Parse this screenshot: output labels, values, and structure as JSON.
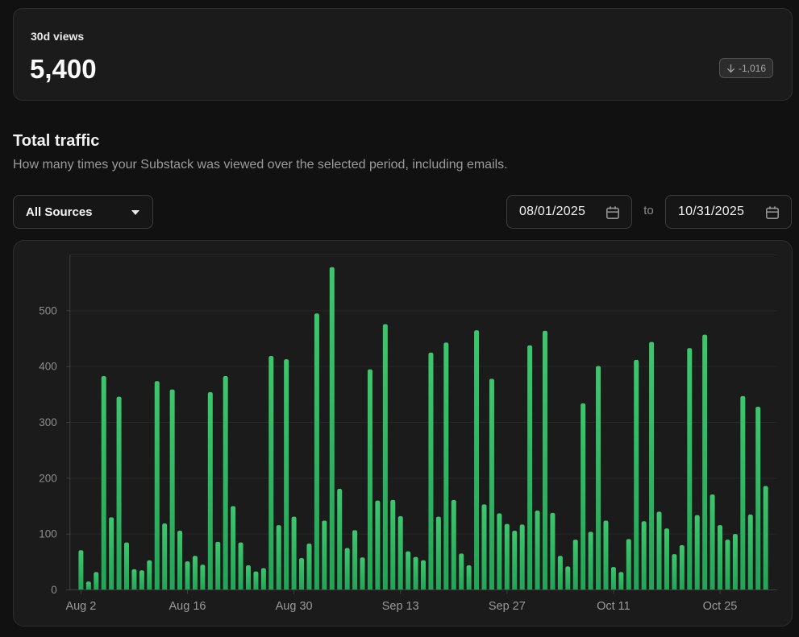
{
  "stat_card": {
    "label": "30d views",
    "value": "5,400",
    "badge": {
      "text": "-1,016",
      "arrow_icon": "arrow-down-icon"
    }
  },
  "section": {
    "title": "Total traffic",
    "subtitle": "How many times your Substack was viewed over the selected period, including emails."
  },
  "controls": {
    "source_select": {
      "value": "All Sources",
      "caret_icon": "chevron-down-icon"
    },
    "date_from": {
      "value": "08/01/2025",
      "icon": "calendar-icon"
    },
    "range_separator": "to",
    "date_to": {
      "value": "10/31/2025",
      "icon": "calendar-icon"
    }
  },
  "chart_data": {
    "type": "bar",
    "title": "Total traffic bar chart",
    "xlabel": "",
    "ylabel": "",
    "y_ticks": [
      0,
      100,
      200,
      300,
      400,
      500
    ],
    "y_max": 600,
    "grid": true,
    "legend": false,
    "x_tick_indices": [
      0,
      14,
      28,
      42,
      56,
      70,
      84
    ],
    "x_tick_labels": [
      "Aug 2",
      "Aug 16",
      "Aug 30",
      "Sep 13",
      "Sep 27",
      "Oct 11",
      "Oct 25"
    ],
    "values": [
      71,
      15,
      32,
      383,
      130,
      346,
      85,
      37,
      35,
      53,
      374,
      119,
      359,
      106,
      51,
      61,
      45,
      354,
      86,
      383,
      150,
      85,
      44,
      33,
      39,
      419,
      116,
      413,
      131,
      57,
      83,
      495,
      124,
      578,
      181,
      75,
      107,
      58,
      395,
      160,
      476,
      161,
      132,
      69,
      59,
      53,
      425,
      131,
      443,
      161,
      65,
      44,
      465,
      153,
      378,
      137,
      118,
      106,
      117,
      438,
      142,
      464,
      138,
      61,
      42,
      90,
      334,
      104,
      401,
      124,
      41,
      32,
      91,
      412,
      123,
      444,
      140,
      110,
      64,
      80,
      433,
      134,
      457,
      171,
      116,
      90,
      100,
      347,
      135,
      328,
      186
    ],
    "colors": {
      "bar_top": "#3dc76d",
      "bar_bottom": "#22a556",
      "grid_line": "#272727",
      "axis_line": "#3f3f3f",
      "axis_text": "#8d8d8d",
      "x_text": "#9a9a9a"
    }
  }
}
